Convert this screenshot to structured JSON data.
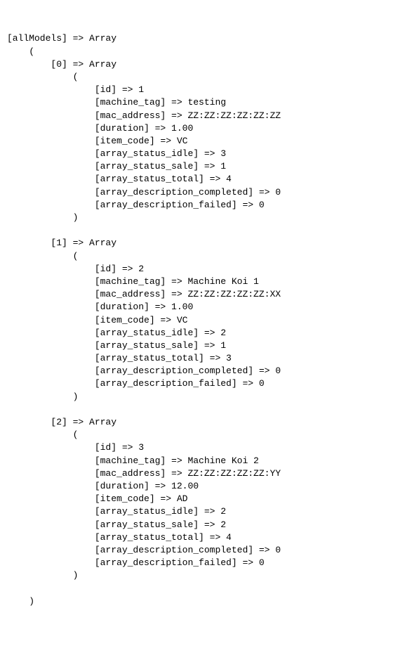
{
  "rootKey": "allModels",
  "arrow": "=>",
  "arrayWord": "Array",
  "items": [
    {
      "index": "0",
      "fields": [
        {
          "key": "id",
          "value": "1"
        },
        {
          "key": "machine_tag",
          "value": "testing"
        },
        {
          "key": "mac_address",
          "value": "ZZ:ZZ:ZZ:ZZ:ZZ:ZZ"
        },
        {
          "key": "duration",
          "value": "1.00"
        },
        {
          "key": "item_code",
          "value": "VC"
        },
        {
          "key": "array_status_idle",
          "value": "3"
        },
        {
          "key": "array_status_sale",
          "value": "1"
        },
        {
          "key": "array_status_total",
          "value": "4"
        },
        {
          "key": "array_description_completed",
          "value": "0"
        },
        {
          "key": "array_description_failed",
          "value": "0"
        }
      ]
    },
    {
      "index": "1",
      "fields": [
        {
          "key": "id",
          "value": "2"
        },
        {
          "key": "machine_tag",
          "value": "Machine Koi 1"
        },
        {
          "key": "mac_address",
          "value": "ZZ:ZZ:ZZ:ZZ:ZZ:XX"
        },
        {
          "key": "duration",
          "value": "1.00"
        },
        {
          "key": "item_code",
          "value": "VC"
        },
        {
          "key": "array_status_idle",
          "value": "2"
        },
        {
          "key": "array_status_sale",
          "value": "1"
        },
        {
          "key": "array_status_total",
          "value": "3"
        },
        {
          "key": "array_description_completed",
          "value": "0"
        },
        {
          "key": "array_description_failed",
          "value": "0"
        }
      ]
    },
    {
      "index": "2",
      "fields": [
        {
          "key": "id",
          "value": "3"
        },
        {
          "key": "machine_tag",
          "value": "Machine Koi 2"
        },
        {
          "key": "mac_address",
          "value": "ZZ:ZZ:ZZ:ZZ:ZZ:YY"
        },
        {
          "key": "duration",
          "value": "12.00"
        },
        {
          "key": "item_code",
          "value": "AD"
        },
        {
          "key": "array_status_idle",
          "value": "2"
        },
        {
          "key": "array_status_sale",
          "value": "2"
        },
        {
          "key": "array_status_total",
          "value": "4"
        },
        {
          "key": "array_description_completed",
          "value": "0"
        },
        {
          "key": "array_description_failed",
          "value": "0"
        }
      ]
    }
  ]
}
